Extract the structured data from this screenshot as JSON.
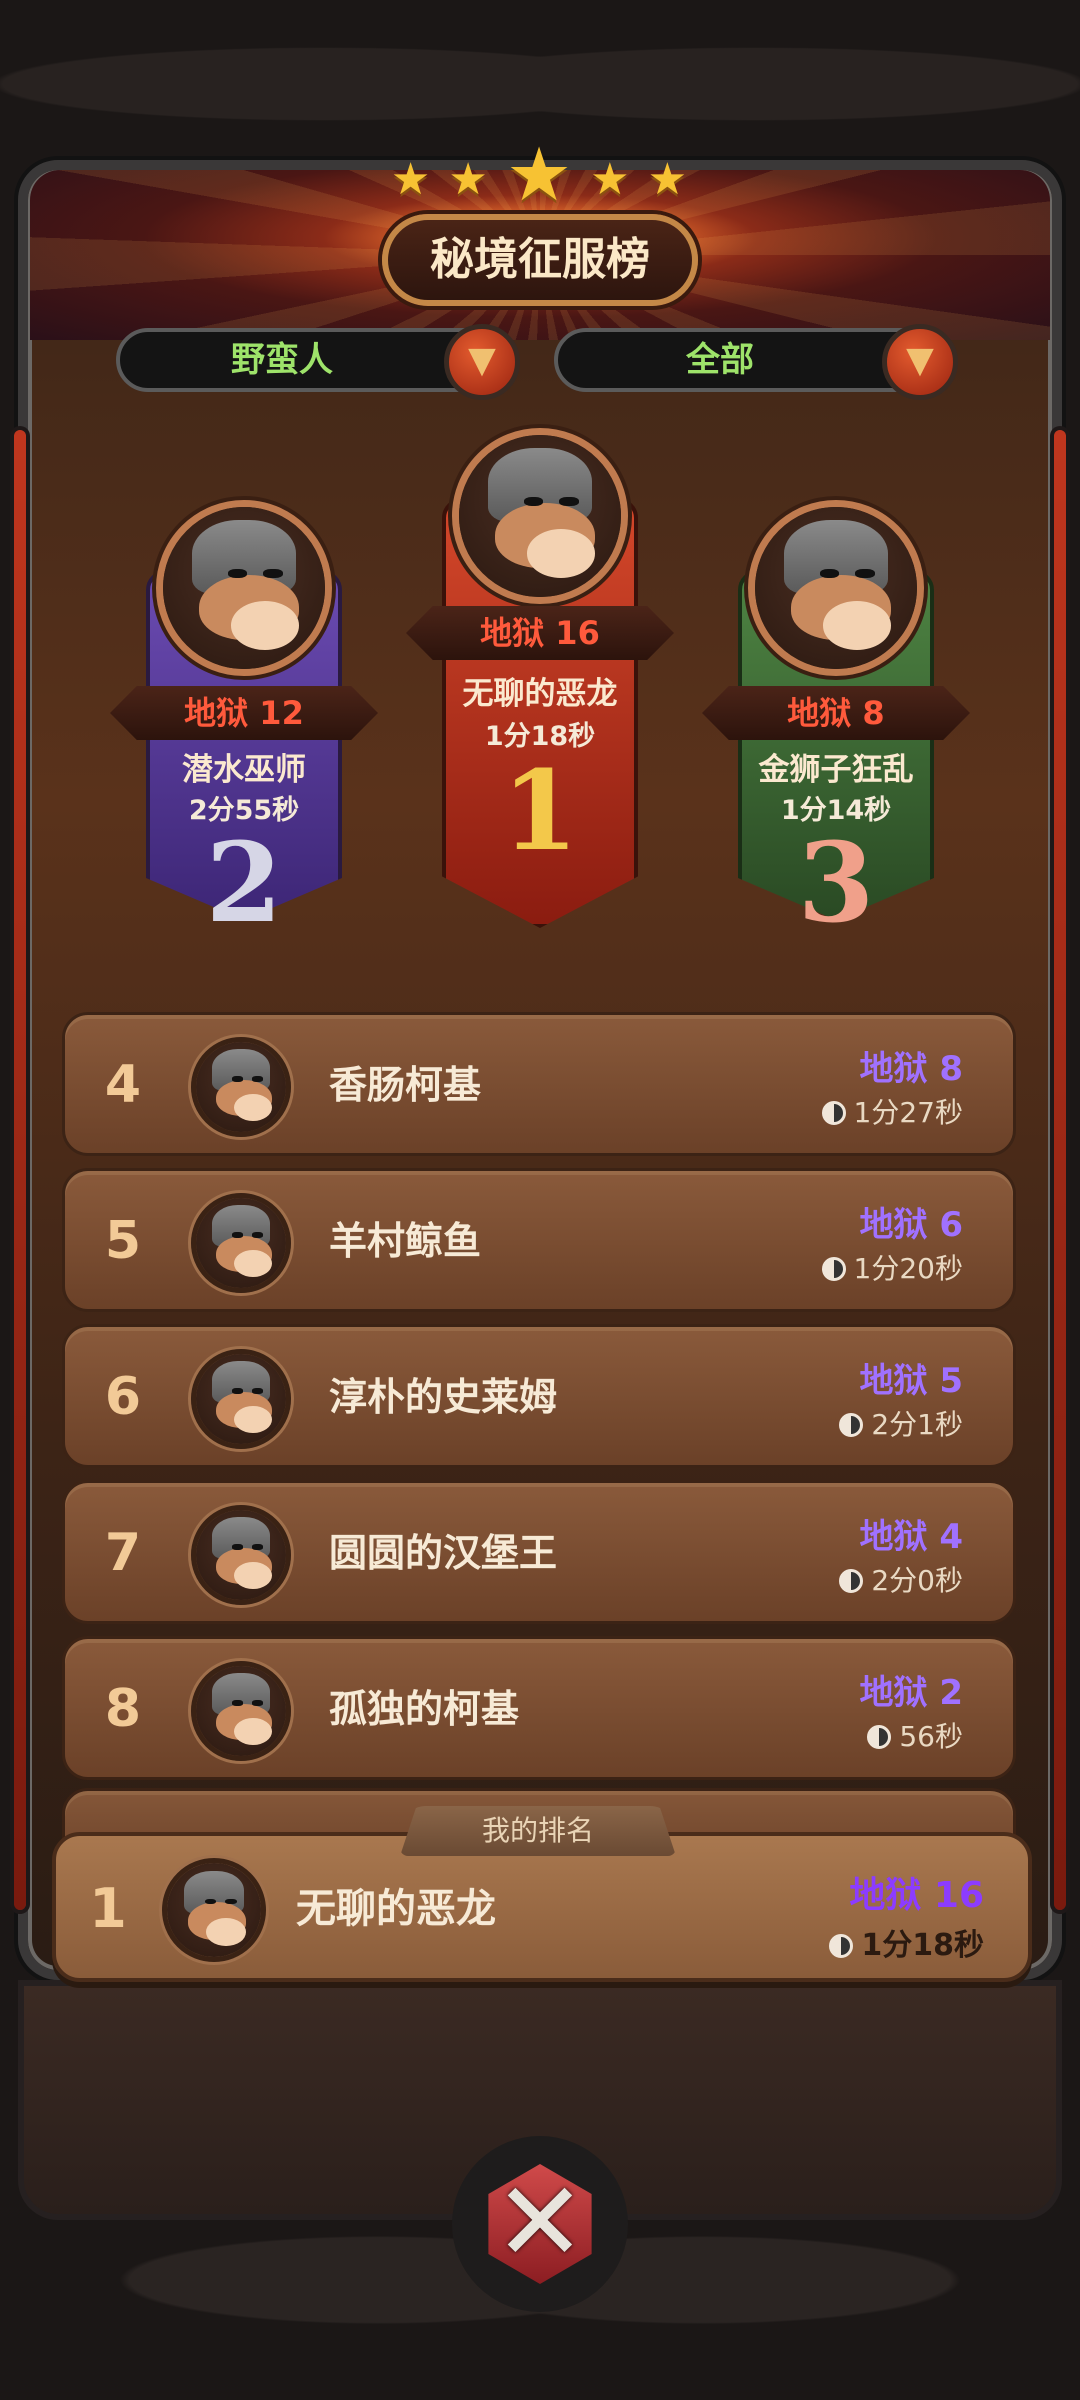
{
  "header": {
    "title": "秘境征服榜",
    "stars": [
      "★",
      "★",
      "★",
      "★",
      "★"
    ]
  },
  "filters": {
    "class_filter": "野蛮人",
    "scope_filter": "全部",
    "dropdown_icon": "▼"
  },
  "podium": [
    {
      "place": "2",
      "level": "地狱 12",
      "name": "潜水巫师",
      "time": "2分55秒",
      "color": "#5b3c9a"
    },
    {
      "place": "1",
      "level": "地狱 16",
      "name": "无聊的恶龙",
      "time": "1分18秒",
      "color": "#b8321a"
    },
    {
      "place": "3",
      "level": "地狱 8",
      "name": "金狮子狂乱",
      "time": "1分14秒",
      "color": "#3f6b34"
    }
  ],
  "leaderboard": [
    {
      "rank": "4",
      "name": "香肠柯基",
      "level": "地狱 8",
      "time": "1分27秒"
    },
    {
      "rank": "5",
      "name": "羊村鲸鱼",
      "level": "地狱 6",
      "time": "1分20秒"
    },
    {
      "rank": "6",
      "name": "淳朴的史莱姆",
      "level": "地狱 5",
      "time": "2分1秒"
    },
    {
      "rank": "7",
      "name": "圆圆的汉堡王",
      "level": "地狱 4",
      "time": "2分0秒"
    },
    {
      "rank": "8",
      "name": "孤独的柯基",
      "level": "地狱 2",
      "time": "56秒"
    }
  ],
  "my_rank": {
    "tab_label": "我的排名",
    "rank": "1",
    "name": "无聊的恶龙",
    "level": "地狱 16",
    "time": "1分18秒"
  },
  "close": {
    "icon": "crossed-swords-icon"
  },
  "colors": {
    "level_purple": "#a071ff",
    "gold_star": "#f7c233",
    "dropdown_text": "#9ee36a"
  }
}
